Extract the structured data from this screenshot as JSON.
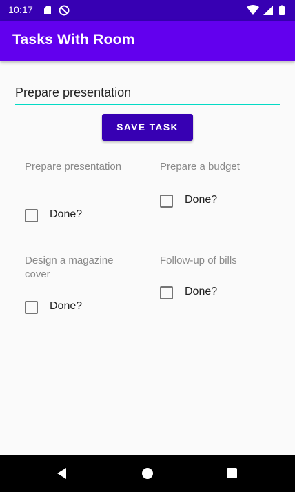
{
  "status_bar": {
    "time": "10:17",
    "icons": [
      "sd-card-icon",
      "do-not-disturb-icon",
      "wifi-icon",
      "signal-icon",
      "battery-icon"
    ]
  },
  "app_bar": {
    "title": "Tasks With Room"
  },
  "form": {
    "input_value": "Prepare presentation",
    "save_label": "SAVE TASK"
  },
  "tasks": [
    {
      "name": "Prepare presentation",
      "done_label": "Done?",
      "done": false
    },
    {
      "name": "Prepare a budget",
      "done_label": "Done?",
      "done": false
    },
    {
      "name": "Design a magazine cover",
      "done_label": "Done?",
      "done": false
    },
    {
      "name": "Follow-up of bills",
      "done_label": "Done?",
      "done": false
    }
  ],
  "nav_bar": {
    "icons": [
      "back-icon",
      "home-icon",
      "recents-icon"
    ]
  },
  "colors": {
    "status_bar": "#3700b3",
    "app_bar": "#6200ee",
    "button": "#3700b3",
    "input_underline": "#03dac5",
    "background": "#fafafa",
    "nav_bar": "#000000"
  }
}
